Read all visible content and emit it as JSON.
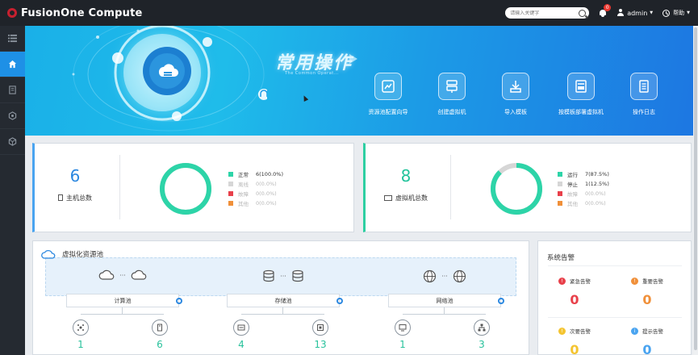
{
  "header": {
    "app_title": "FusionOne Compute",
    "search_placeholder": "请输入关键字",
    "notification_count": "0",
    "user_name": "admin",
    "help_label": "帮助"
  },
  "nav": {
    "items": [
      {
        "icon": "list-icon",
        "active": false
      },
      {
        "icon": "home-icon",
        "active": true
      },
      {
        "icon": "document-icon",
        "active": false
      },
      {
        "icon": "hexagon-icon",
        "active": false
      },
      {
        "icon": "cube-icon",
        "active": false
      }
    ]
  },
  "banner": {
    "title": "常用操作",
    "subtitle": "The Common Operat...",
    "quick_ops": [
      {
        "label": "资源池配置向导",
        "icon": "resource-pool-icon"
      },
      {
        "label": "创建虚拟机",
        "icon": "create-vm-icon"
      },
      {
        "label": "导入模板",
        "icon": "import-template-icon"
      },
      {
        "label": "按模板部署虚拟机",
        "icon": "deploy-template-icon"
      },
      {
        "label": "操作日志",
        "icon": "log-icon"
      }
    ]
  },
  "colors": {
    "accent": "#1e90e6",
    "normal": "#2dd4a8",
    "offline": "#d6d6d6",
    "fault": "#e8404a",
    "other": "#f0903a",
    "host_number": "#2c88e0",
    "vm_number": "#22c39b"
  },
  "host_summary": {
    "count": "6",
    "label": "主机总数",
    "ratio": 1.0,
    "legend": [
      {
        "name": "正常",
        "value": "6(100.0%)",
        "color": "#2dd4a8",
        "dim": false
      },
      {
        "name": "离线",
        "value": "0(0.0%)",
        "color": "#d6d6d6",
        "dim": true
      },
      {
        "name": "故障",
        "value": "0(0.0%)",
        "color": "#e8404a",
        "dim": true
      },
      {
        "name": "其他",
        "value": "0(0.0%)",
        "color": "#f0903a",
        "dim": true
      }
    ]
  },
  "vm_summary": {
    "count": "8",
    "label": "虚拟机总数",
    "ratio": 0.875,
    "legend": [
      {
        "name": "运行",
        "value": "7(87.5%)",
        "color": "#2dd4a8",
        "dim": false
      },
      {
        "name": "停止",
        "value": "1(12.5%)",
        "color": "#d6d6d6",
        "dim": false
      },
      {
        "name": "故障",
        "value": "0(0.0%)",
        "color": "#e8404a",
        "dim": true
      },
      {
        "name": "其他",
        "value": "0(0.0%)",
        "color": "#f0903a",
        "dim": true
      }
    ]
  },
  "resource_pool": {
    "title": "虚拟化资源池",
    "dots": "···",
    "groups": [
      {
        "label": "计算池",
        "icon": "cloud-icon",
        "sub": [
          {
            "icon": "cluster-icon",
            "value": "1"
          },
          {
            "icon": "host-icon",
            "value": "6"
          }
        ]
      },
      {
        "label": "存储池",
        "icon": "database-icon",
        "sub": [
          {
            "icon": "storage-device-icon",
            "value": "4"
          },
          {
            "icon": "datastore-icon",
            "value": "13"
          }
        ]
      },
      {
        "label": "网络池",
        "icon": "globe-icon",
        "sub": [
          {
            "icon": "monitor-icon",
            "value": "1"
          },
          {
            "icon": "network-tree-icon",
            "value": "3"
          }
        ]
      }
    ]
  },
  "alarms": {
    "title": "系统告警",
    "items": [
      {
        "name": "紧急告警",
        "count": "0",
        "color": "#e8404a",
        "glyph": "!"
      },
      {
        "name": "重要告警",
        "count": "0",
        "color": "#f0903a",
        "glyph": "!"
      },
      {
        "name": "次要告警",
        "count": "0",
        "color": "#f4c430",
        "glyph": "!"
      },
      {
        "name": "提示告警",
        "count": "0",
        "color": "#4aa4f0",
        "glyph": "i"
      }
    ]
  }
}
